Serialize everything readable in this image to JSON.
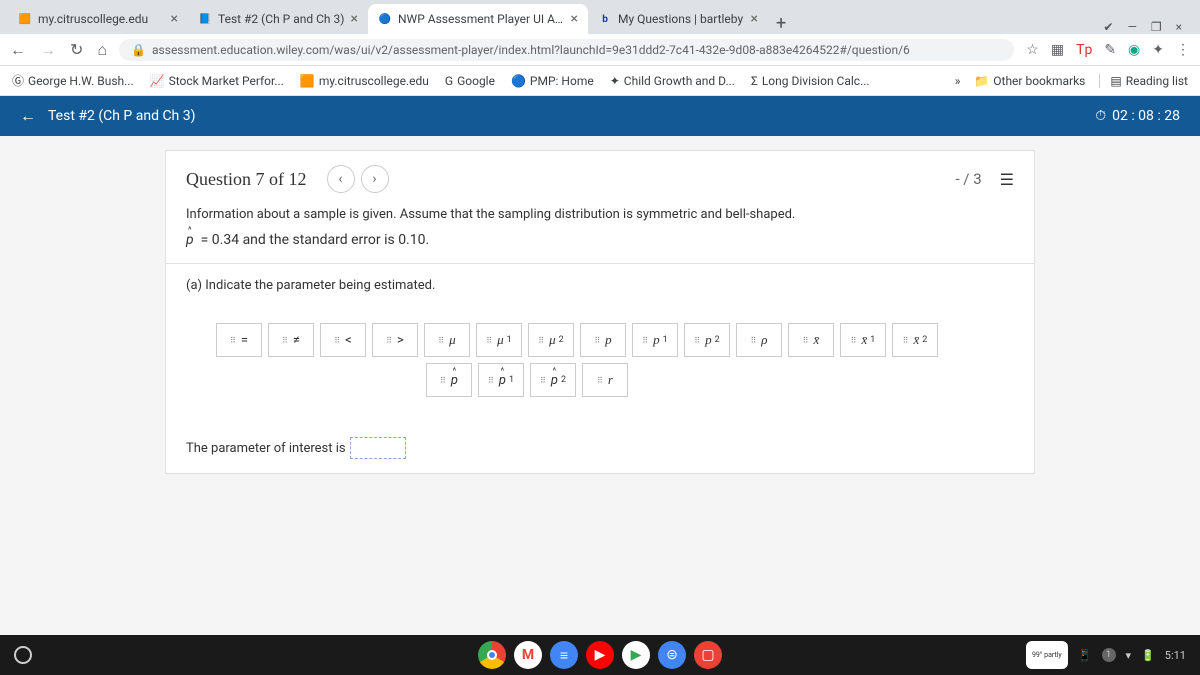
{
  "browser": {
    "tabs": [
      {
        "title": "my.citruscollege.edu",
        "favicon": "🟧"
      },
      {
        "title": "Test #2 (Ch P and Ch 3)",
        "favicon": "📘"
      },
      {
        "title": "NWP Assessment Player UI Appl",
        "favicon": "🔵",
        "active": true
      },
      {
        "title": "My Questions | bartleby",
        "favicon": "b"
      }
    ],
    "url": "assessment.education.wiley.com/was/ui/v2/assessment-player/index.html?launchId=9e31ddd2-7c41-432e-9d08-a883e4264522#/question/6",
    "bookmarks": [
      {
        "label": "George H.W. Bush...",
        "icon": "Ⓖ"
      },
      {
        "label": "Stock Market Perfor...",
        "icon": "📈"
      },
      {
        "label": "my.citruscollege.edu",
        "icon": "🟧"
      },
      {
        "label": "Google",
        "icon": "G"
      },
      {
        "label": "PMP: Home",
        "icon": "🔵"
      },
      {
        "label": "Child Growth and D...",
        "icon": "✦"
      },
      {
        "label": "Long Division Calc...",
        "icon": "Σ"
      }
    ],
    "other_bookmarks": "Other bookmarks",
    "reading_list": "Reading list"
  },
  "assessment": {
    "title": "Test #2 (Ch P and Ch 3)",
    "timer": "02 : 08 : 28",
    "question_label": "Question 7 of 12",
    "score": "- / 3",
    "info_text": "Information about a sample is given. Assume that the sampling distribution is symmetric and bell-shaped.",
    "phat_value": "= 0.34 and the standard error is 0.10.",
    "part_a": "(a) Indicate the parameter being estimated.",
    "answer_prompt": "The parameter of interest is",
    "symbols_row1": [
      "=",
      "≠",
      "<",
      ">",
      "μ",
      "μ₁",
      "μ₂",
      "p",
      "p₁",
      "p₂",
      "ρ",
      "x̄",
      "x̄₁",
      "x̄₂"
    ],
    "symbols_row2": [
      "p̂",
      "p̂₁",
      "p̂₂",
      "r"
    ]
  },
  "system": {
    "time": "5:11",
    "badge": "1"
  }
}
